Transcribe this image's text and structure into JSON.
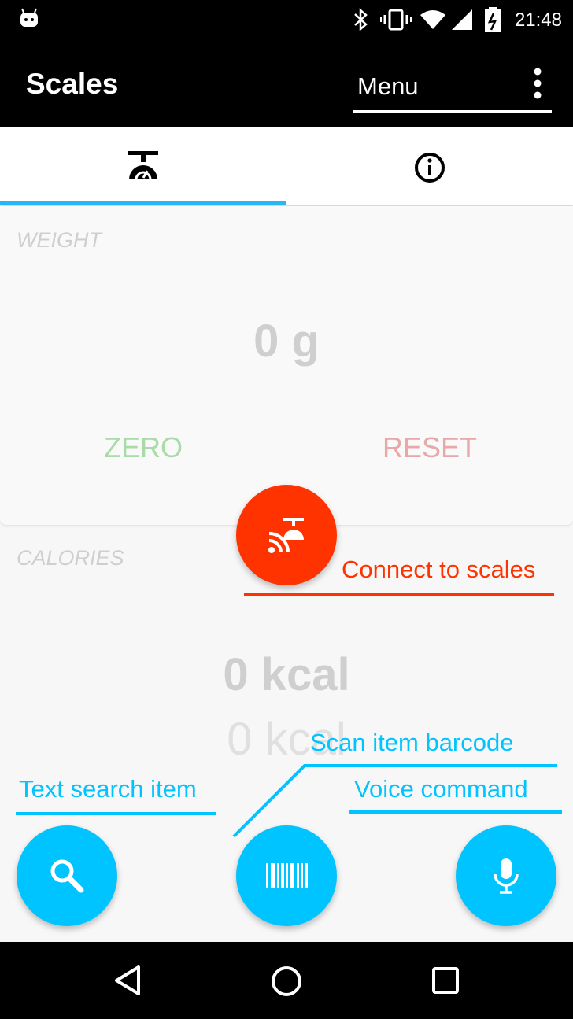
{
  "status_bar": {
    "time": "21:48"
  },
  "app_bar": {
    "title": "Scales",
    "menu_label": "Menu"
  },
  "tabs": [
    {
      "icon": "scales-icon",
      "selected": true
    },
    {
      "icon": "info-icon",
      "selected": false
    }
  ],
  "weight_card": {
    "label": "WEIGHT",
    "value": "0 g",
    "zero_label": "ZERO",
    "reset_label": "RESET"
  },
  "calories": {
    "label": "CALORIES",
    "value": "0 kcal",
    "value_secondary": "0 kcal"
  },
  "annotations": {
    "connect": "Connect to scales",
    "scan": "Scan item barcode",
    "text_search": "Text search item",
    "voice": "Voice command"
  },
  "colors": {
    "accent": "#00c4ff",
    "connect_red": "#ff3300",
    "zero_green": "#a8dba8",
    "reset_red": "#e6a8a8",
    "tab_indicator": "#29b6f6"
  }
}
